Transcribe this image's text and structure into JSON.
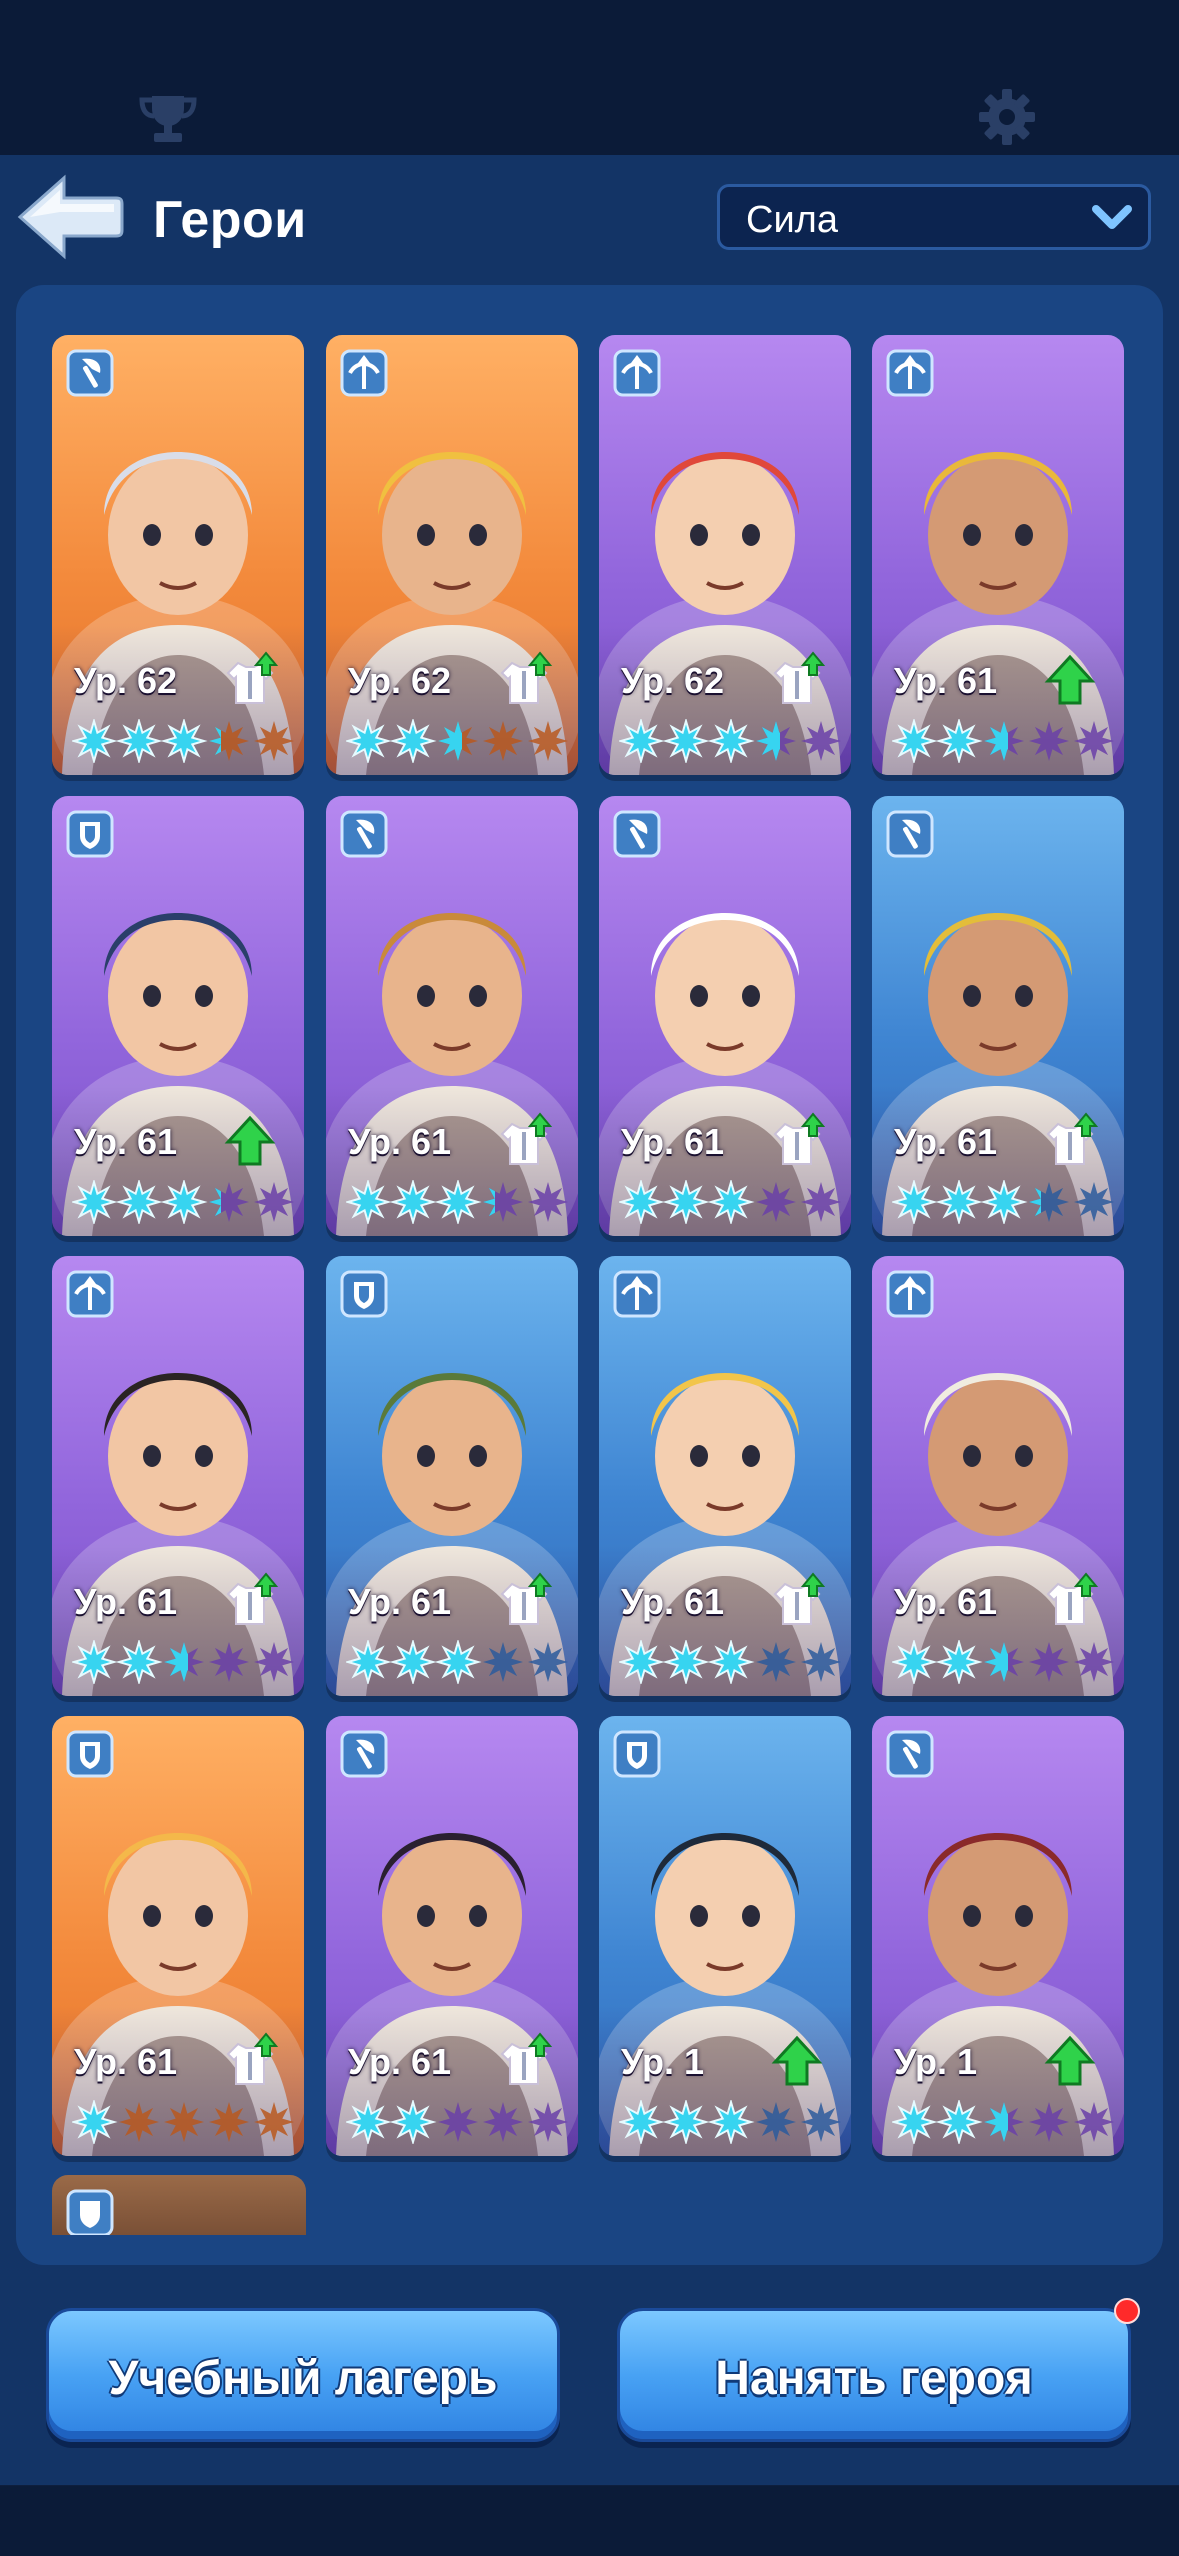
{
  "header": {
    "title": "Герои",
    "sort_value": "Сила"
  },
  "colors": {
    "orange_card": "#f38a3c",
    "purple_card": "#9266dc",
    "blue_card": "#3f85d2",
    "star_filled": "#37d4f0",
    "star_empty": "#6a3fa8",
    "button": "#48a2f4",
    "notification": "#ff2a2a"
  },
  "heroes": [
    {
      "level": "Ур. 62",
      "rarity": "orange",
      "class_icon": "axe-icon",
      "stars_filled": 3,
      "stars_partial": 0.3,
      "gear_upgrade": true
    },
    {
      "level": "Ур. 62",
      "rarity": "orange",
      "class_icon": "crossbow-icon",
      "stars_filled": 2,
      "stars_partial": 0.6,
      "gear_upgrade": true
    },
    {
      "level": "Ур. 62",
      "rarity": "purple",
      "class_icon": "crossbow-icon",
      "stars_filled": 3,
      "stars_partial": 0.6,
      "gear_upgrade": true
    },
    {
      "level": "Ур. 61",
      "rarity": "purple",
      "class_icon": "crossbow-icon",
      "stars_filled": 2,
      "stars_partial": 0.6,
      "gear_upgrade": false
    },
    {
      "level": "Ур. 61",
      "rarity": "purple",
      "class_icon": "shield-icon",
      "stars_filled": 3,
      "stars_partial": 0.3,
      "gear_upgrade": false
    },
    {
      "level": "Ур. 61",
      "rarity": "purple",
      "class_icon": "axe-icon",
      "stars_filled": 3,
      "stars_partial": 0.3,
      "gear_upgrade": true
    },
    {
      "level": "Ур. 61",
      "rarity": "purple",
      "class_icon": "axe-icon",
      "stars_filled": 3,
      "stars_partial": 0,
      "gear_upgrade": true
    },
    {
      "level": "Ур. 61",
      "rarity": "blue",
      "class_icon": "axe-icon",
      "stars_filled": 3,
      "stars_partial": 0.3,
      "gear_upgrade": true
    },
    {
      "level": "Ур. 61",
      "rarity": "purple",
      "class_icon": "crossbow-icon",
      "stars_filled": 2,
      "stars_partial": 0.6,
      "gear_upgrade": true
    },
    {
      "level": "Ур. 61",
      "rarity": "blue",
      "class_icon": "shield-icon",
      "stars_filled": 3,
      "stars_partial": 0,
      "gear_upgrade": true
    },
    {
      "level": "Ур. 61",
      "rarity": "blue",
      "class_icon": "crossbow-icon",
      "stars_filled": 3,
      "stars_partial": 0,
      "gear_upgrade": true
    },
    {
      "level": "Ур. 61",
      "rarity": "purple",
      "class_icon": "crossbow-icon",
      "stars_filled": 2,
      "stars_partial": 0.6,
      "gear_upgrade": true
    },
    {
      "level": "Ур. 61",
      "rarity": "orange",
      "class_icon": "shield-icon",
      "stars_filled": 1,
      "stars_partial": 0,
      "gear_upgrade": true
    },
    {
      "level": "Ур. 61",
      "rarity": "purple",
      "class_icon": "axe-icon",
      "stars_filled": 2,
      "stars_partial": 0,
      "gear_upgrade": true
    },
    {
      "level": "Ур. 1",
      "rarity": "blue",
      "class_icon": "shield-icon",
      "stars_filled": 3,
      "stars_partial": 0,
      "gear_upgrade": false
    },
    {
      "level": "Ур. 1",
      "rarity": "purple",
      "class_icon": "axe-icon",
      "stars_filled": 2,
      "stars_partial": 0.6,
      "gear_upgrade": false
    }
  ],
  "buttons": {
    "training_camp": "Учебный лагерь",
    "hire_hero": "Нанять героя"
  }
}
